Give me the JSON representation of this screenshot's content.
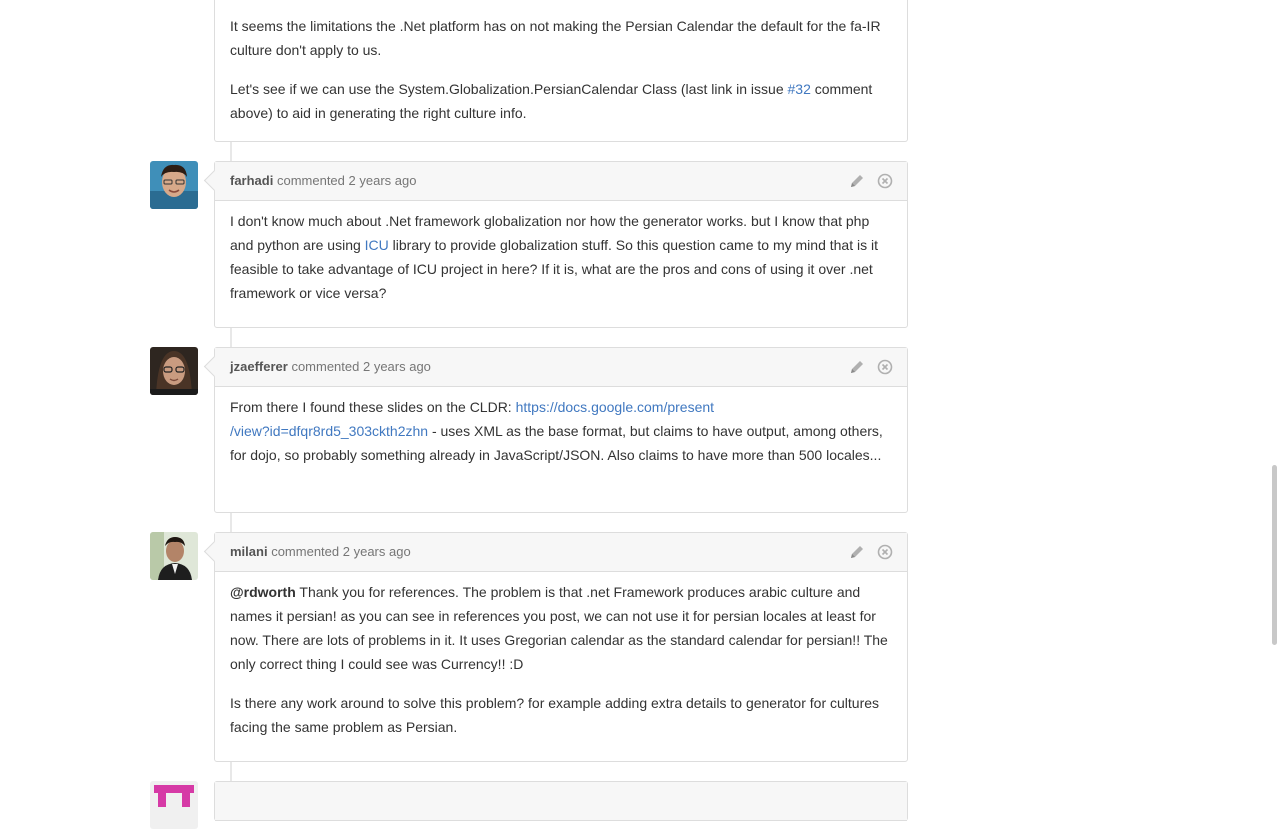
{
  "first_comment": {
    "paragraphs": [
      "It seems the limitations the .Net platform has on not making the Persian Calendar the default for the fa-IR culture don't apply to us.",
      "Let's see if we can use the System.Globalization.PersianCalendar Class (last link in issue "
    ],
    "issue_link": "#32",
    "tail": " comment above) to aid in generating the right culture info."
  },
  "comments": [
    {
      "author": "farhadi",
      "verb": "commented",
      "time": "2 years ago",
      "p1_a": "I don't know much about .Net framework globalization nor how the generator works. but I know that php and python are using ",
      "p1_link": "ICU",
      "p1_b": " library to provide globalization stuff. So this question came to my mind that is it feasible to take advantage of ICU project in here? If it is, what are the pros and cons of using it over .net framework or vice versa?"
    },
    {
      "author": "jzaefferer",
      "verb": "commented",
      "time": "2 years ago",
      "p1_a": "From there I found these slides on the CLDR: ",
      "p1_link_1": "https://docs.google.com/present",
      "p1_link_2": "/view?id=dfqr8rd5_303ckth2zhn",
      "p1_b": " - uses XML as the base format, but claims to have output, among others, for dojo, so probably something already in JavaScript/JSON. Also claims to have more than 500 locales..."
    },
    {
      "author": "milani",
      "verb": "commented",
      "time": "2 years ago",
      "mention": "@rdworth",
      "p1": " Thank you for references. The problem is that .net Framework produces arabic culture and names it persian! as you can see in references you post, we can not use it for persian locales at least for now. There are lots of problems in it. It uses Gregorian calendar as the standard calendar for persian!! The only correct thing I could see was Currency!! :D",
      "p2": "Is there any work around to solve this problem? for example adding extra details to generator for cultures facing the same problem as Persian."
    }
  ],
  "icons": [
    "pencil-icon",
    "close-icon"
  ],
  "colors": {
    "link": "#4078c0",
    "header_bg": "#f7f7f7",
    "border": "#dddddd"
  }
}
